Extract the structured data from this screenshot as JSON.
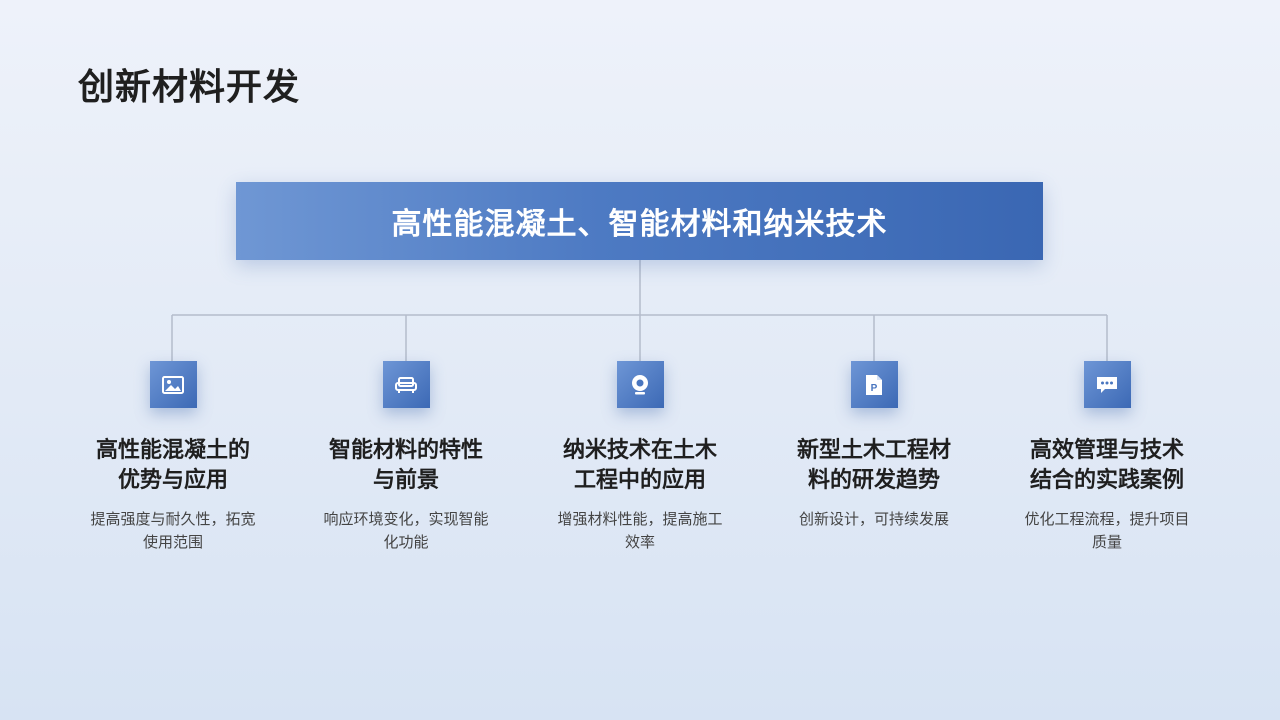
{
  "page": {
    "title": "创新材料开发"
  },
  "root": {
    "label": "高性能混凝土、智能材料和纳米技术"
  },
  "nodes": [
    {
      "icon": "image-icon",
      "title_line1": "高性能混凝土的",
      "title_line2": "优势与应用",
      "desc_line1": "提高强度与耐久性，拓宽",
      "desc_line2": "使用范围"
    },
    {
      "icon": "sofa-icon",
      "title_line1": "智能材料的特性",
      "title_line2": "与前景",
      "desc_line1": "响应环境变化，实现智能",
      "desc_line2": "化功能"
    },
    {
      "icon": "webcam-icon",
      "title_line1": "纳米技术在土木",
      "title_line2": "工程中的应用",
      "desc_line1": "增强材料性能，提高施工",
      "desc_line2": "效率"
    },
    {
      "icon": "parking-document-icon",
      "title_line1": "新型土木工程材",
      "title_line2": "料的研发趋势",
      "desc_line1": "创新设计，可持续发展",
      "desc_line2": ""
    },
    {
      "icon": "chat-bubble-icon",
      "title_line1": "高效管理与技术",
      "title_line2": "结合的实践案例",
      "desc_line1": "优化工程流程，提升项目",
      "desc_line2": "质量"
    }
  ],
  "colors": {
    "accent": "#3c69b5",
    "accent_light": "#6e96d6",
    "connector": "#b4bccb",
    "background": "#e6edf7"
  }
}
